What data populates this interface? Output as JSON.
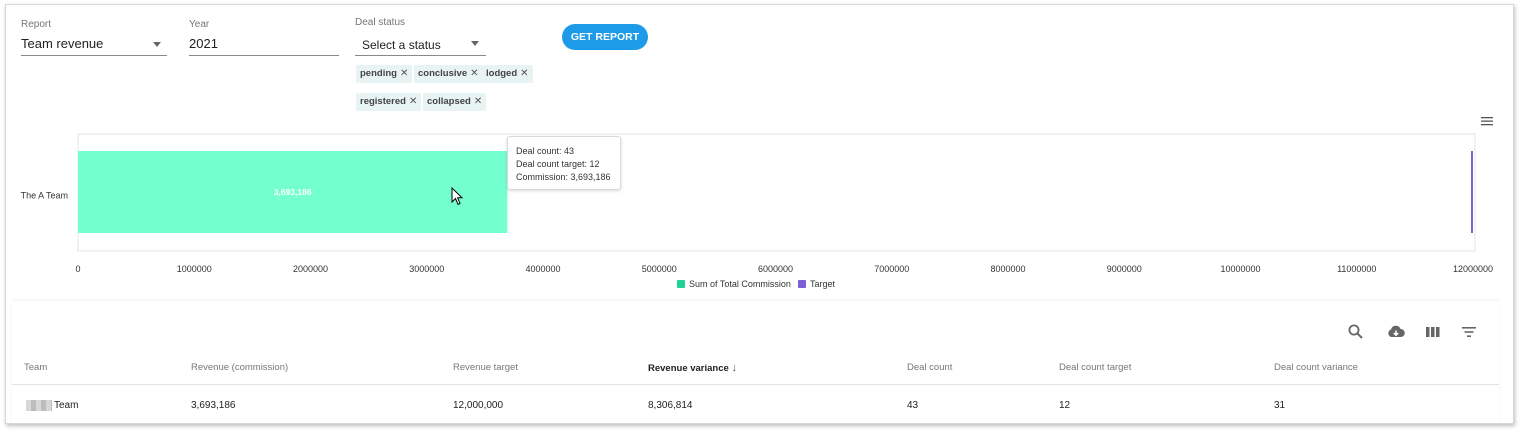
{
  "filters": {
    "report": {
      "label": "Report",
      "value": "Team revenue"
    },
    "year": {
      "label": "Year",
      "value": "2021"
    },
    "deal_status": {
      "label": "Deal status",
      "placeholder": "Select a status",
      "chips": [
        "pending",
        "conclusive",
        "lodged",
        "registered",
        "collapsed"
      ]
    },
    "get_report_label": "GET REPORT"
  },
  "chart_data": {
    "type": "bar",
    "orientation": "horizontal",
    "categories": [
      "The A Team"
    ],
    "series": [
      {
        "name": "Sum of Total Commission",
        "values": [
          3693186
        ],
        "color": "#73ffce"
      },
      {
        "name": "Target",
        "values": [
          12000000
        ],
        "color": "#7e5fd6",
        "style": "marker"
      }
    ],
    "data_labels": [
      "3,693,186"
    ],
    "xlim": [
      0,
      12000000
    ],
    "xticks": [
      0,
      1000000,
      2000000,
      3000000,
      4000000,
      5000000,
      6000000,
      7000000,
      8000000,
      9000000,
      10000000,
      11000000,
      12000000
    ],
    "xtick_labels": [
      "0",
      "1000000",
      "2000000",
      "3000000",
      "4000000",
      "5000000",
      "6000000",
      "7000000",
      "8000000",
      "9000000",
      "10000000",
      "11000000",
      "12000000"
    ],
    "legend_position": "bottom",
    "legend": [
      {
        "label": "Sum of Total Commission",
        "color": "#1fd394"
      },
      {
        "label": "Target",
        "color": "#7e5fd6"
      }
    ],
    "tooltip": {
      "lines": [
        "Deal count: 43",
        "Deal count target: 12",
        "Commission: 3,693,186"
      ]
    }
  },
  "table": {
    "toolbar_icons": [
      "search-icon",
      "cloud-download-icon",
      "view-columns-icon",
      "filter-icon"
    ],
    "columns": [
      "Team",
      "Revenue (commission)",
      "Revenue target",
      "Revenue variance",
      "Deal count",
      "Deal count target",
      "Deal count variance"
    ],
    "sorted_column": "Revenue variance",
    "rows": [
      [
        "Team",
        "3,693,186",
        "12,000,000",
        "8,306,814",
        "43",
        "12",
        "31"
      ]
    ]
  }
}
